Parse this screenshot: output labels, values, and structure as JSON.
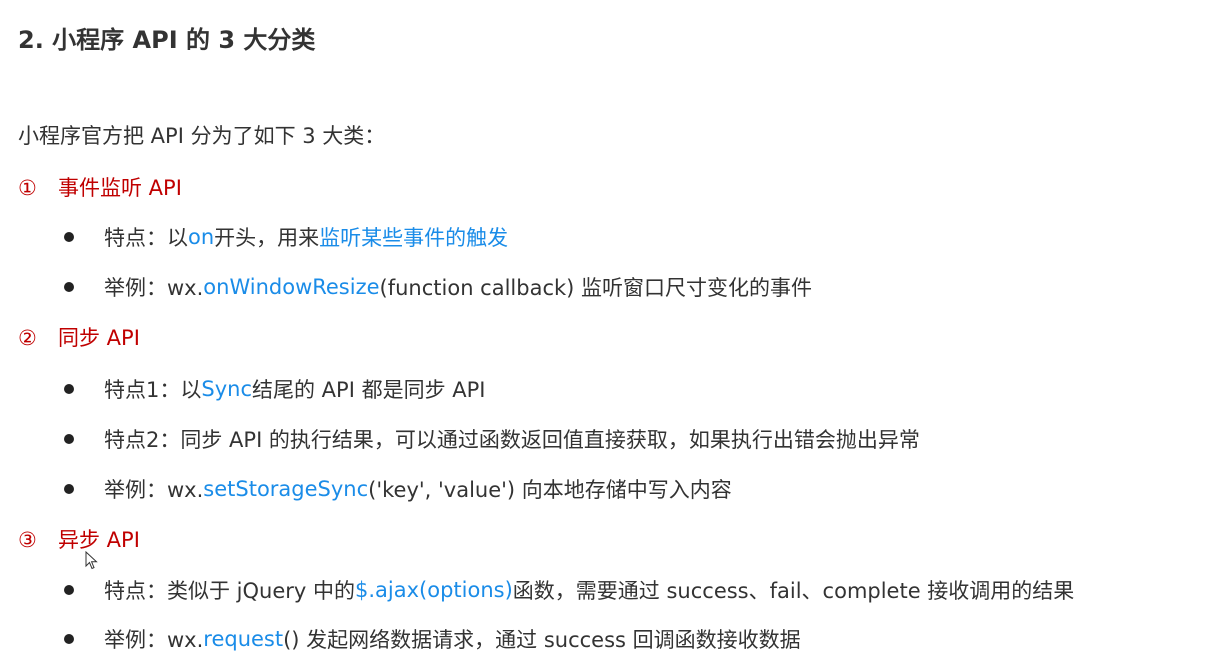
{
  "title": "2. 小程序 API 的 3 大分类",
  "intro": "小程序官方把 API 分为了如下 3 大类：",
  "sections": [
    {
      "marker": "①",
      "heading": "事件监听 API",
      "items": [
        {
          "parts": [
            "特点：以 ",
            "on",
            " 开头，用来",
            "监听某些事件的触发",
            ""
          ]
        },
        {
          "parts": [
            "举例：wx.",
            "onWindowResize",
            "(function callback) 监听窗口尺寸变化的事件",
            "",
            ""
          ]
        }
      ]
    },
    {
      "marker": "②",
      "heading": "同步 API",
      "items": [
        {
          "parts": [
            "特点1：以 ",
            "Sync",
            " 结尾的 API 都是同步 API",
            "",
            ""
          ]
        },
        {
          "parts": [
            "特点2：同步 API 的执行结果，可以通过函数返回值直接获取，如果执行出错会抛出异常",
            "",
            "",
            "",
            ""
          ]
        },
        {
          "parts": [
            "举例：wx.",
            "setStorageSync",
            "('key', 'value') 向本地存储中写入内容",
            "",
            ""
          ]
        }
      ]
    },
    {
      "marker": "③",
      "heading": "异步 API",
      "items": [
        {
          "parts": [
            "特点：类似于 jQuery 中的 ",
            "$.ajax(options)",
            " 函数，需要通过 success、fail、complete 接收调用的结果",
            "",
            ""
          ]
        },
        {
          "parts": [
            "举例：wx.",
            "request",
            "() 发起网络数据请求，通过 success 回调函数接收数据",
            "",
            ""
          ]
        }
      ]
    }
  ],
  "colors": {
    "heading_red": "#c00000",
    "highlight_blue": "#1a8ce8",
    "body_text": "#333333"
  }
}
